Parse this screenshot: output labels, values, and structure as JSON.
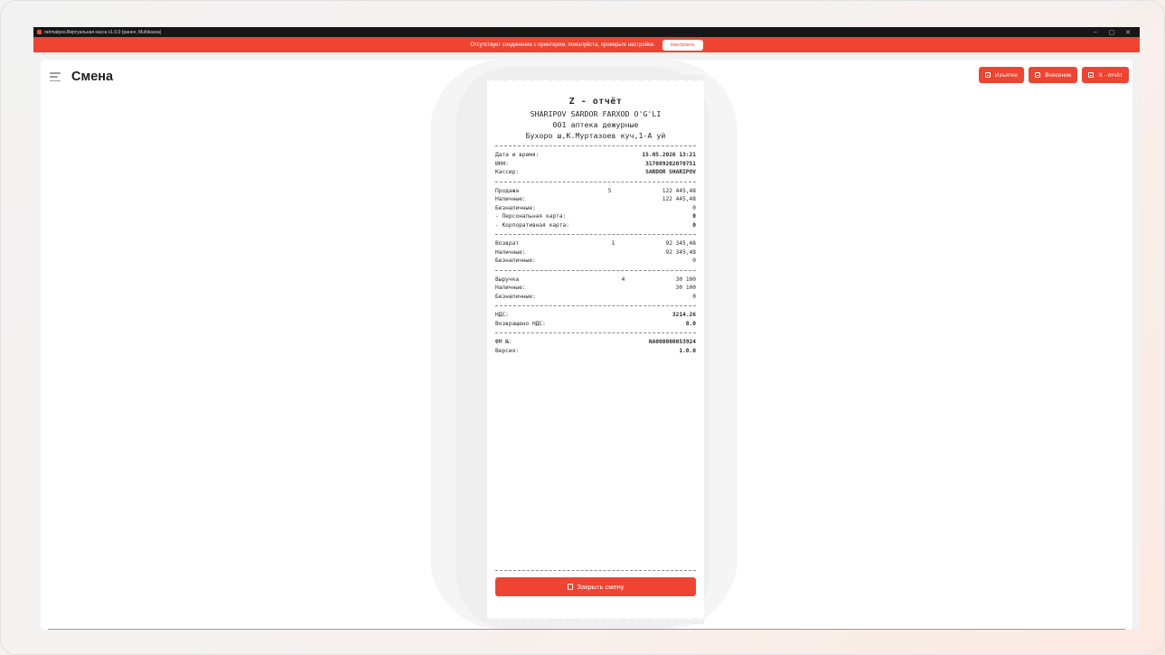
{
  "window": {
    "title": "rahmatpos.Виртуальная касса v1.0.0 (ранее, Multikassa)",
    "controls": [
      "–",
      "▢",
      "✕"
    ]
  },
  "alert": {
    "message": "Отсутствует соединение с принтером, пожалуйста, проверьте настройки.",
    "configure_label": "Настроить"
  },
  "header": {
    "title": "Смена",
    "actions": [
      {
        "label": "Изъятие",
        "icon": "cash-icon"
      },
      {
        "label": "Внесение",
        "icon": "cash-icon"
      },
      {
        "label": "X - отчёт",
        "icon": "report-icon"
      }
    ]
  },
  "receipt": {
    "title": "Z - отчёт",
    "lines": [
      "SHARIPOV SARDOR FARXOD O'G'LI",
      "001 аптека дежурные",
      "Бухоро ш,К.Муртазоев куч,1-А уй"
    ],
    "info": [
      {
        "label": "Дата и время:",
        "value": "15.05.2026 13:21"
      },
      {
        "label": "ИНН:",
        "value": "317089202070751"
      },
      {
        "label": "Кассир:",
        "value": "SARDOR SHARIPOV"
      }
    ],
    "sales": [
      {
        "label": "Продажа",
        "count": "5",
        "value": "122 445,48"
      },
      {
        "label": "Наличные:",
        "count": "",
        "value": "122 445,48"
      },
      {
        "label": "Безналичные:",
        "count": "",
        "value": "0"
      },
      {
        "label": " - Персональная карта:",
        "count": "",
        "value": "0"
      },
      {
        "label": " - Корпоративная карта:",
        "count": "",
        "value": "0"
      }
    ],
    "returns": [
      {
        "label": "Возврат",
        "count": "1",
        "value": "92 345,48"
      },
      {
        "label": "Наличные:",
        "count": "",
        "value": "92 345,48"
      },
      {
        "label": "Безналичные:",
        "count": "",
        "value": "0"
      }
    ],
    "revenue": [
      {
        "label": "Выручка",
        "count": "4",
        "value": "30 100"
      },
      {
        "label": "Наличные:",
        "count": "",
        "value": "30 100"
      },
      {
        "label": "Безналичные:",
        "count": "",
        "value": "0"
      }
    ],
    "vat": [
      {
        "label": "НДС:",
        "value": "3214.26"
      },
      {
        "label": "Возвращено НДС:",
        "value": "0.0"
      }
    ],
    "fiscal": [
      {
        "label": "ФМ №:",
        "value": "NA000000053924"
      },
      {
        "label": "Версия:",
        "value": "1.0.0"
      }
    ],
    "close_label": "Закрыть смену"
  },
  "colors": {
    "accent": "#ef4431",
    "titlebar": "#161616"
  }
}
